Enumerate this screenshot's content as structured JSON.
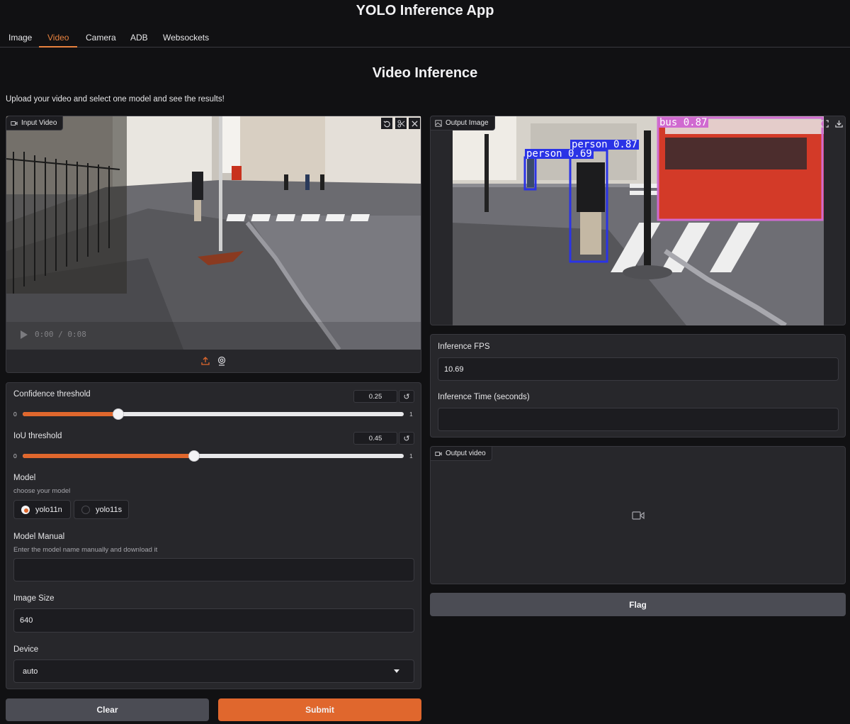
{
  "app": {
    "title": "YOLO Inference App"
  },
  "tabs": [
    {
      "label": "Image"
    },
    {
      "label": "Video"
    },
    {
      "label": "Camera"
    },
    {
      "label": "ADB"
    },
    {
      "label": "Websockets"
    }
  ],
  "active_tab": "Video",
  "section": {
    "title": "Video Inference",
    "description": "Upload your video and select one model and see the results!"
  },
  "input_video": {
    "label": "Input Video",
    "time_display": "0:00 / 0:08",
    "icons": [
      "undo-icon",
      "scissors-icon",
      "close-icon",
      "upload-icon",
      "webcam-icon"
    ]
  },
  "confidence": {
    "label": "Confidence threshold",
    "value": "0.25",
    "min": "0",
    "max": "1",
    "fraction": 0.25
  },
  "iou": {
    "label": "IoU threshold",
    "value": "0.45",
    "min": "0",
    "max": "1",
    "fraction": 0.45
  },
  "model": {
    "label": "Model",
    "info": "choose your model",
    "options": [
      "yolo11n",
      "yolo11s"
    ],
    "selected": "yolo11n"
  },
  "model_manual": {
    "label": "Model Manual",
    "info": "Enter the model name manually and download it",
    "value": ""
  },
  "image_size": {
    "label": "Image Size",
    "value": "640"
  },
  "device": {
    "label": "Device",
    "value": "auto"
  },
  "buttons": {
    "clear": "Clear",
    "submit": "Submit",
    "flag": "Flag"
  },
  "output_image": {
    "label": "Output Image",
    "detections": [
      {
        "text": "person 0.69",
        "color": "#2a33e6"
      },
      {
        "text": "person 0.87",
        "color": "#2a33e6"
      },
      {
        "text": "bus 0.87",
        "color": "#d06ad0"
      }
    ]
  },
  "inference_fps": {
    "label": "Inference FPS",
    "value": "10.69"
  },
  "inference_time": {
    "label": "Inference Time (seconds)",
    "value": ""
  },
  "output_video": {
    "label": "Output video"
  },
  "colors": {
    "accent": "#e0672d",
    "background": "#111113",
    "panel": "#27272b",
    "secondary_button": "#4b4c54"
  }
}
